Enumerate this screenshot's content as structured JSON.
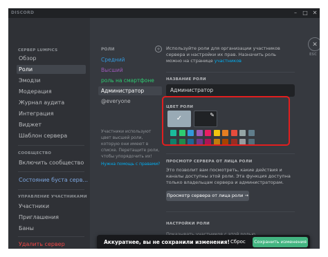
{
  "titlebar": {
    "app": "DISCORD",
    "minimize": "–",
    "maximize": "□",
    "close": "✕"
  },
  "sidebar": {
    "section_server": "СЕРВЕР LUMPICS",
    "items_server": [
      {
        "label": "Обзор"
      },
      {
        "label": "Роли"
      },
      {
        "label": "Эмодзи"
      },
      {
        "label": "Модерация"
      },
      {
        "label": "Журнал аудита"
      },
      {
        "label": "Интеграция"
      },
      {
        "label": "Виджет"
      },
      {
        "label": "Шаблон сервера"
      }
    ],
    "section_community": "СООБЩЕСТВО",
    "community_item": "Включить сообщество",
    "boost_item": "Состояние буста серв...",
    "section_members": "УПРАВЛЕНИЕ УЧАСТНИКАМИ",
    "items_members": [
      {
        "label": "Участники"
      },
      {
        "label": "Приглашения"
      },
      {
        "label": "Баны"
      }
    ],
    "delete_item": "Удалить сервер"
  },
  "roles": {
    "header": "РОЛИ",
    "add": "+",
    "items": [
      {
        "label": "Средний",
        "color": "#3498db"
      },
      {
        "label": "Высший",
        "color": "#9b59b6"
      },
      {
        "label": "роль на смартфоне",
        "color": "#2ecc71"
      },
      {
        "label": "Администратор",
        "color": "#ffffff"
      },
      {
        "label": "@everyone",
        "color": "#b9bbbe"
      }
    ],
    "note": "Участники используют цвет высшей роли, которую они имеют в списке. Перетащите роли, чтобы упорядочить их!",
    "help_link": "Нужна помощь с правами?"
  },
  "main": {
    "intro_text": "Используйте роли для организации участников сервера и настройки их прав. Назначить роль можно на странице ",
    "intro_link": "участников",
    "role_name_label": "НАЗВАНИЕ РОЛИ",
    "role_name_value": "Администратор",
    "role_color_label": "ЦВЕТ РОЛИ",
    "default_swatch_color": "#99aab5",
    "check_glyph": "✓",
    "picker_glyph": "✎",
    "swatches_row1": [
      "#1abc9c",
      "#2ecc71",
      "#3498db",
      "#9b59b6",
      "#e91e63",
      "#f1c40f",
      "#e67e22",
      "#e74c3c",
      "#95a5a6",
      "#607d8b"
    ],
    "swatches_row2": [
      "#11806a",
      "#1f8b4c",
      "#206694",
      "#71368a",
      "#ad1457",
      "#c27c0e",
      "#a84300",
      "#992d22",
      "#979c9f",
      "#546e7a"
    ],
    "preview_label": "ПРОСМОТР СЕРВЕРА ОТ ЛИЦА РОЛИ",
    "preview_text": "Это позволит вам посмотреть, какие действия и каналы доступны этой роли. Эта функция доступна только владельцам сервера и администраторам.",
    "preview_button": "Просмотр сервера от лица роли →",
    "settings_label": "НАСТРОЙКИ РОЛИ",
    "settings_hidden_text": "Показывать участников с этой ролью"
  },
  "esc": {
    "icon": "✕",
    "label": "ESC"
  },
  "notice": {
    "message": "Аккуратнее, вы не сохранили изменения!",
    "reset": "Сброс",
    "save": "Сохранить изменения"
  }
}
